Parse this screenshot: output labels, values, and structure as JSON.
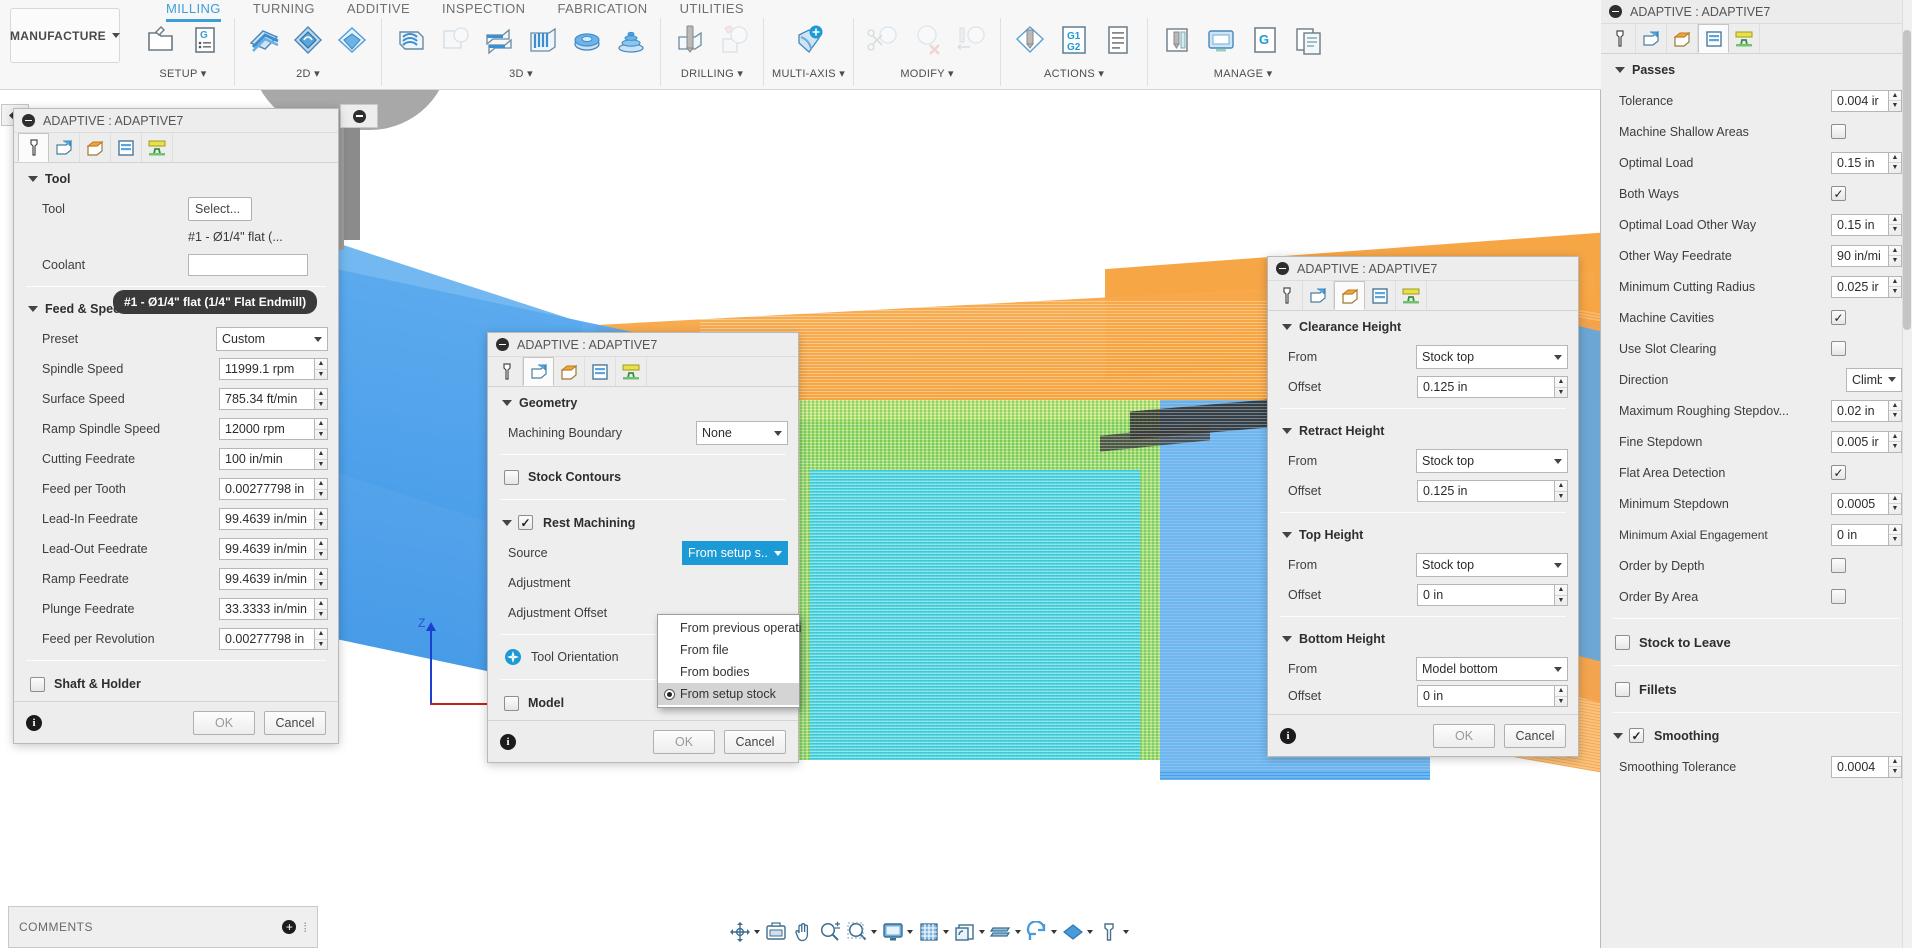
{
  "app": {
    "workspace_label": "MANUFACTURE",
    "ribbon_tabs": [
      {
        "label": "MILLING",
        "active": true
      },
      {
        "label": "TURNING",
        "active": false
      },
      {
        "label": "ADDITIVE",
        "active": false
      },
      {
        "label": "INSPECTION",
        "active": false
      },
      {
        "label": "FABRICATION",
        "active": false
      },
      {
        "label": "UTILITIES",
        "active": false
      }
    ],
    "ribbon_groups": [
      {
        "label": "SETUP",
        "icons": [
          "setup-folder-icon",
          "g-code-list-icon"
        ]
      },
      {
        "label": "2D",
        "icons": [
          "face-2d-icon",
          "adaptive-2d-icon",
          "pocket-2d-icon"
        ]
      },
      {
        "label": "3D",
        "icons": [
          "adaptive-3d-icon",
          "pocket-3d-icon",
          "horizontal-3d-icon",
          "parallel-3d-icon",
          "scallop-3d-icon",
          "spiral-3d-icon"
        ]
      },
      {
        "label": "DRILLING",
        "icons": [
          "drill-icon",
          "bore-icon"
        ]
      },
      {
        "label": "MULTI-AXIS",
        "icons": [
          "multi-axis-icon"
        ]
      },
      {
        "label": "MODIFY",
        "icons": [
          "trim-icon",
          "delete-icon",
          "extend-icon"
        ]
      },
      {
        "label": "ACTIONS",
        "icons": [
          "simulate-icon",
          "post-process-g1g2-icon",
          "setup-sheet-icon"
        ]
      },
      {
        "label": "MANAGE",
        "icons": [
          "tool-library-icon",
          "machine-library-icon",
          "generate-icon",
          "template-icon"
        ]
      }
    ]
  },
  "tool_palette": {
    "title": "ADAPTIVE : ADAPTIVE7",
    "tabs": [
      "tool-tab-icon",
      "geometry-tab-icon",
      "heights-tab-icon",
      "passes-tab-icon",
      "linking-tab-icon"
    ],
    "active_tab_index": 0,
    "sections": {
      "tool": {
        "header": "Tool",
        "tool_label": "Tool",
        "select_button": "Select...",
        "tool_value": "#1 - Ø1/4\" flat (...",
        "coolant_label": "Coolant",
        "tooltip": "#1 - Ø1/4\" flat (1/4\" Flat Endmill)"
      },
      "feed_speed": {
        "header": "Feed & Speed",
        "rows": [
          {
            "label": "Preset",
            "value": "Custom",
            "type": "combo"
          },
          {
            "label": "Spindle Speed",
            "value": "11999.1 rpm",
            "type": "spin"
          },
          {
            "label": "Surface Speed",
            "value": "785.34 ft/min",
            "type": "spin"
          },
          {
            "label": "Ramp Spindle Speed",
            "value": "12000 rpm",
            "type": "spin"
          },
          {
            "label": "Cutting Feedrate",
            "value": "100 in/min",
            "type": "spin"
          },
          {
            "label": "Feed per Tooth",
            "value": "0.00277798 in",
            "type": "spin"
          },
          {
            "label": "Lead-In Feedrate",
            "value": "99.4639 in/min",
            "type": "spin"
          },
          {
            "label": "Lead-Out Feedrate",
            "value": "99.4639 in/min",
            "type": "spin"
          },
          {
            "label": "Ramp Feedrate",
            "value": "99.4639 in/min",
            "type": "spin"
          },
          {
            "label": "Plunge Feedrate",
            "value": "33.3333 in/min",
            "type": "spin"
          },
          {
            "label": "Feed per Revolution",
            "value": "0.00277798 in",
            "type": "spin"
          }
        ]
      },
      "shaft_holder": {
        "header": "Shaft & Holder",
        "checked": false
      }
    },
    "footer": {
      "ok": "OK",
      "cancel": "Cancel",
      "info": "i"
    }
  },
  "geometry_palette": {
    "title": "ADAPTIVE : ADAPTIVE7",
    "active_tab_index": 1,
    "sections": {
      "geometry": {
        "header": "Geometry",
        "machining_boundary_label": "Machining Boundary",
        "machining_boundary_value": "None"
      },
      "stock_contours": {
        "label": "Stock Contours",
        "checked": false
      },
      "rest_machining": {
        "header": "Rest Machining",
        "checked": true,
        "source_label": "Source",
        "source_value": "From setup s...",
        "adjustment_label": "Adjustment",
        "adjustment_offset_label": "Adjustment Offset",
        "dropdown_open": true,
        "dropdown_options": [
          {
            "label": "From previous operati",
            "selected": false
          },
          {
            "label": "From file",
            "selected": false
          },
          {
            "label": "From bodies",
            "selected": false
          },
          {
            "label": "From setup stock",
            "selected": true
          }
        ]
      },
      "tool_orientation": {
        "label": "Tool Orientation",
        "icon": "orientation-icon"
      },
      "model": {
        "label": "Model",
        "checked": false
      }
    },
    "footer": {
      "ok": "OK",
      "cancel": "Cancel",
      "info": "i"
    }
  },
  "heights_palette": {
    "title": "ADAPTIVE : ADAPTIVE7",
    "active_tab_index": 2,
    "groups": [
      {
        "header": "Clearance Height",
        "from_label": "From",
        "from_value": "Stock top",
        "offset_label": "Offset",
        "offset_value": "0.125 in"
      },
      {
        "header": "Retract Height",
        "from_label": "From",
        "from_value": "Stock top",
        "offset_label": "Offset",
        "offset_value": "0.125 in"
      },
      {
        "header": "Top Height",
        "from_label": "From",
        "from_value": "Stock top",
        "offset_label": "Offset",
        "offset_value": "0 in"
      },
      {
        "header": "Bottom Height",
        "from_label": "From",
        "from_value": "Model bottom",
        "offset_label": "Offset",
        "offset_value": "0 in"
      }
    ],
    "footer": {
      "ok": "OK",
      "cancel": "Cancel",
      "info": "i"
    }
  },
  "passes_palette": {
    "title": "ADAPTIVE : ADAPTIVE7",
    "active_tab_index": 3,
    "section_header": "Passes",
    "rows": [
      {
        "label": "Tolerance",
        "type": "spin",
        "value": "0.004 ir"
      },
      {
        "label": "Machine Shallow Areas",
        "type": "check",
        "checked": false
      },
      {
        "label": "Optimal Load",
        "type": "spin",
        "value": "0.15 in"
      },
      {
        "label": "Both Ways",
        "type": "check",
        "checked": true
      },
      {
        "label": "Optimal Load Other Way",
        "type": "spin",
        "value": "0.15 in"
      },
      {
        "label": "Other Way Feedrate",
        "type": "spin",
        "value": "90 in/mi"
      },
      {
        "label": "Minimum Cutting Radius",
        "type": "spin",
        "value": "0.025 ir"
      },
      {
        "label": "Machine Cavities",
        "type": "check",
        "checked": true
      },
      {
        "label": "Use Slot Clearing",
        "type": "check",
        "checked": false
      },
      {
        "label": "Direction",
        "type": "combo",
        "value": "Climb"
      },
      {
        "label": "Maximum Roughing Stepdov...",
        "type": "spin",
        "value": "0.02 in"
      },
      {
        "label": "Fine Stepdown",
        "type": "spin",
        "value": "0.005 ir"
      },
      {
        "label": "Flat Area Detection",
        "type": "check",
        "checked": true
      },
      {
        "label": "Minimum Stepdown",
        "type": "spin",
        "value": "0.0005"
      },
      {
        "label": "Minimum Axial Engagement",
        "type": "spin",
        "value": "0 in"
      },
      {
        "label": "Order by Depth",
        "type": "check",
        "checked": false
      },
      {
        "label": "Order By Area",
        "type": "check",
        "checked": false
      }
    ],
    "stock_to_leave": {
      "label": "Stock to Leave",
      "checked": false
    },
    "fillets": {
      "label": "Fillets",
      "checked": false
    },
    "smoothing": {
      "label": "Smoothing",
      "checked": true,
      "tolerance_label": "Smoothing Tolerance",
      "tolerance_value": "0.0004"
    }
  },
  "bottom": {
    "comments_title": "COMMENTS",
    "nav_items": [
      {
        "icon": "orbit-icon",
        "has_arrow": true
      },
      {
        "icon": "look-at-icon",
        "has_arrow": false
      },
      {
        "icon": "pan-hand-icon",
        "has_arrow": false
      },
      {
        "icon": "zoom-plus-minus-icon",
        "has_arrow": false
      },
      {
        "icon": "zoom-window-icon",
        "has_arrow": true
      },
      {
        "icon": "display-settings-icon",
        "has_arrow": true
      },
      {
        "icon": "grid-snap-icon",
        "has_arrow": true
      },
      {
        "icon": "viewports-icon",
        "has_arrow": true
      },
      {
        "icon": "multiple-views-icon",
        "has_arrow": true
      },
      {
        "icon": "refresh-icon",
        "has_arrow": true
      },
      {
        "icon": "appearance-icon",
        "has_arrow": true
      },
      {
        "icon": "tool-display-icon",
        "has_arrow": true
      }
    ]
  },
  "viewport": {
    "axis_z_label": "Z"
  },
  "colors": {
    "accent_blue": "#3b9fd6",
    "selection_blue": "#1c9ad6",
    "stock_orange": "#f4a03a",
    "toolpath_blue": "#3f97e7",
    "toolpath_green": "#76c95a",
    "panel_bg": "#eeeeee"
  }
}
